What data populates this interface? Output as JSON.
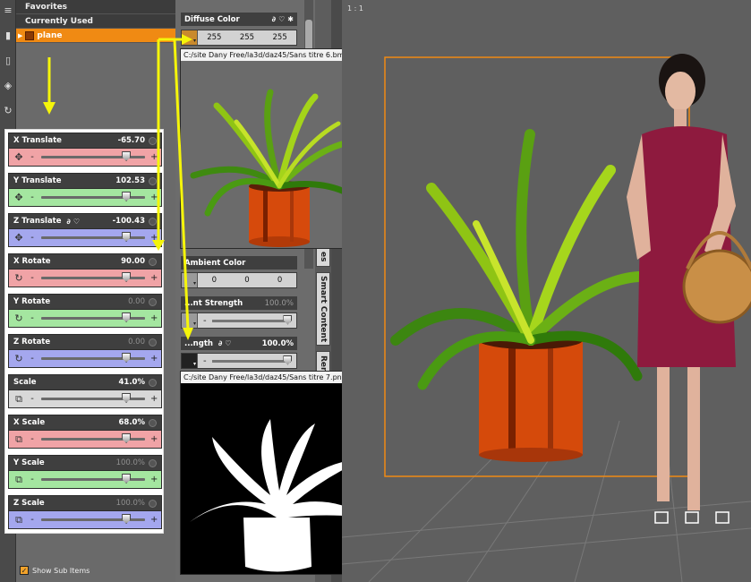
{
  "scene": {
    "items": [
      {
        "label": "Favorites"
      },
      {
        "label": "Currently Used"
      }
    ],
    "selected_item": "plane",
    "show_sub_items_label": "Show Sub Items"
  },
  "parameters": [
    {
      "label": "X Translate",
      "value": "-65.70",
      "color": "red",
      "icon": "move-icon",
      "slider": 0.82,
      "dim": false
    },
    {
      "label": "Y Translate",
      "value": "102.53",
      "color": "green",
      "icon": "move-icon",
      "slider": 0.82,
      "dim": false
    },
    {
      "label": "Z Translate",
      "value": "-100.43",
      "color": "blue",
      "icon": "move-icon",
      "slider": 0.82,
      "dim": false,
      "extra": true
    },
    {
      "label": "X Rotate",
      "value": "90.00",
      "color": "red",
      "icon": "rotate-icon",
      "slider": 0.82,
      "dim": false
    },
    {
      "label": "Y Rotate",
      "value": "0.00",
      "color": "green",
      "icon": "rotate-icon",
      "slider": 0.82,
      "dim": true
    },
    {
      "label": "Z Rotate",
      "value": "0.00",
      "color": "blue",
      "icon": "rotate-icon",
      "slider": 0.82,
      "dim": true
    },
    {
      "label": "Scale",
      "value": "41.0%",
      "color": "gray",
      "icon": "scale-icon",
      "slider": 0.82,
      "dim": false
    },
    {
      "label": "X Scale",
      "value": "68.0%",
      "color": "red",
      "icon": "scale-icon",
      "slider": 0.82,
      "dim": false
    },
    {
      "label": "Y Scale",
      "value": "100.0%",
      "color": "green",
      "icon": "scale-icon",
      "slider": 0.82,
      "dim": true
    },
    {
      "label": "Z Scale",
      "value": "100.0%",
      "color": "blue",
      "icon": "scale-icon",
      "slider": 0.82,
      "dim": true
    }
  ],
  "surfaces": {
    "diffuse": {
      "label": "Diffuse Color",
      "r": "255",
      "g": "255",
      "b": "255"
    },
    "ambient": {
      "label": "Ambient Color",
      "r": "0",
      "g": "0",
      "b": "0"
    },
    "ambient_strength": {
      "label": "...nt Strength",
      "value": "100.0%"
    },
    "cutout": {
      "label": "...ngth",
      "value": "100.0%"
    }
  },
  "previews": {
    "diffuse_path": "C:/site Dany Free/la3d/daz45/Sans titre 6.bmp",
    "opacity_path": "C:/site Dany Free/la3d/daz45/Sans titre 7.png"
  },
  "tabs": {
    "tab_a": "es",
    "smart_content": "Smart Content",
    "tab_c": "Ren"
  },
  "viewport": {
    "label": "1 : 1"
  },
  "colors": {
    "accent": "#f08a13",
    "arrow": "#f5f50a"
  }
}
